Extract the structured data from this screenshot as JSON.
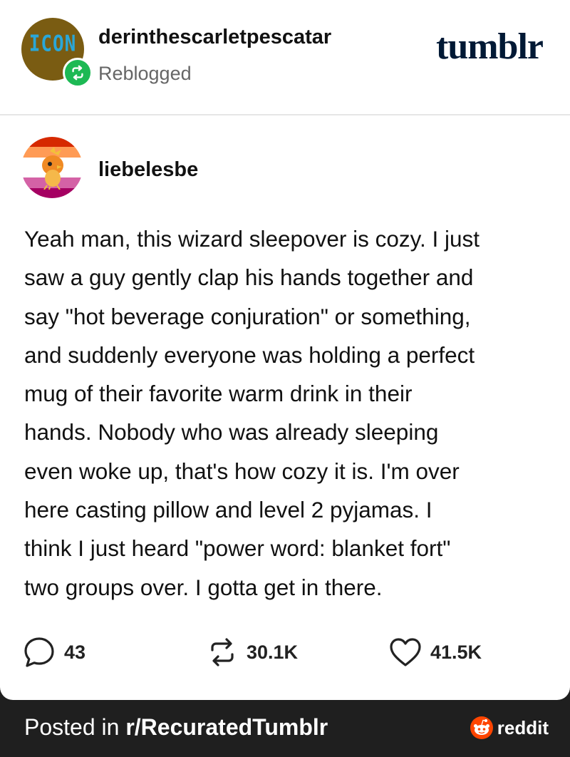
{
  "reblog_header": {
    "avatar_text": "ICON",
    "username": "derinthescarletpescatar",
    "status": "Reblogged",
    "platform_logo": "tumblr",
    "badge_icon": "reblog-icon",
    "badge_color": "#1db954"
  },
  "post": {
    "author": "liebelesbe",
    "avatar_flag_colors": [
      "#d62900",
      "#ff9b55",
      "#ffffff",
      "#d462a6",
      "#a50062"
    ],
    "body_lines": [
      "Yeah man, this wizard sleepover is cozy. I just",
      "saw a guy gently clap his hands together and",
      "say \"hot beverage conjuration\" or something,",
      "and suddenly everyone was holding a perfect",
      "mug of their favorite warm drink in their",
      "hands. Nobody who was already sleeping",
      "even woke up, that's how cozy it is. I'm over",
      "here casting pillow and level 2 pyjamas. I",
      "think I just heard \"power word: blanket fort\"",
      "two groups over. I gotta get in there."
    ]
  },
  "stats": {
    "comments": {
      "icon": "comment-icon",
      "count": "43"
    },
    "reblogs": {
      "icon": "reblog-icon",
      "count": "30.1K"
    },
    "likes": {
      "icon": "heart-icon",
      "count": "41.5K"
    }
  },
  "footer": {
    "prefix": "Posted in ",
    "subreddit": "r/RecuratedTumblr",
    "brand": "reddit",
    "brand_icon": "reddit-snoo-icon",
    "brand_color": "#ff4500"
  }
}
